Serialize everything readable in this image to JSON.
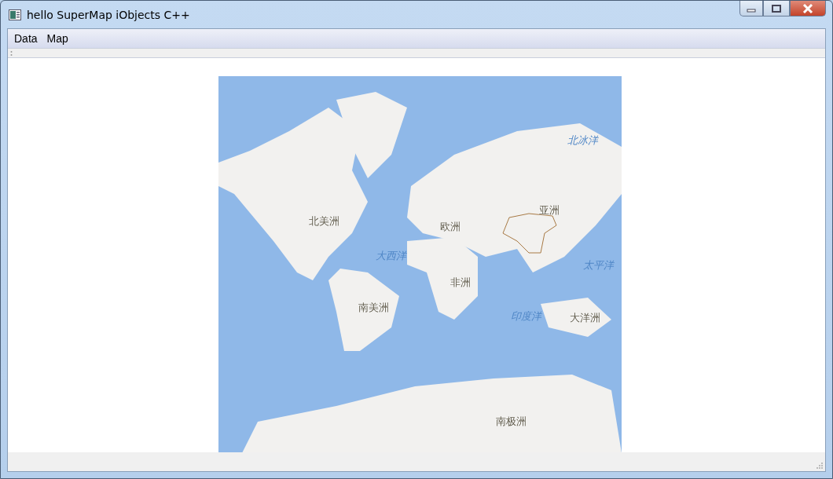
{
  "window": {
    "title": "hello SuperMap iObjects C++"
  },
  "menu": [
    "Data",
    "Map"
  ],
  "map": {
    "labels": [
      {
        "text": "北冰洋",
        "kind": "ocean"
      },
      {
        "text": "亚洲",
        "kind": "continent"
      },
      {
        "text": "北美洲",
        "kind": "continent"
      },
      {
        "text": "欧洲",
        "kind": "continent"
      },
      {
        "text": "大西洋",
        "kind": "ocean"
      },
      {
        "text": "太平洋",
        "kind": "ocean"
      },
      {
        "text": "非洲",
        "kind": "continent"
      },
      {
        "text": "南美洲",
        "kind": "continent"
      },
      {
        "text": "印度洋",
        "kind": "ocean"
      },
      {
        "text": "大洋洲",
        "kind": "continent"
      },
      {
        "text": "南极洲",
        "kind": "continent"
      }
    ]
  }
}
